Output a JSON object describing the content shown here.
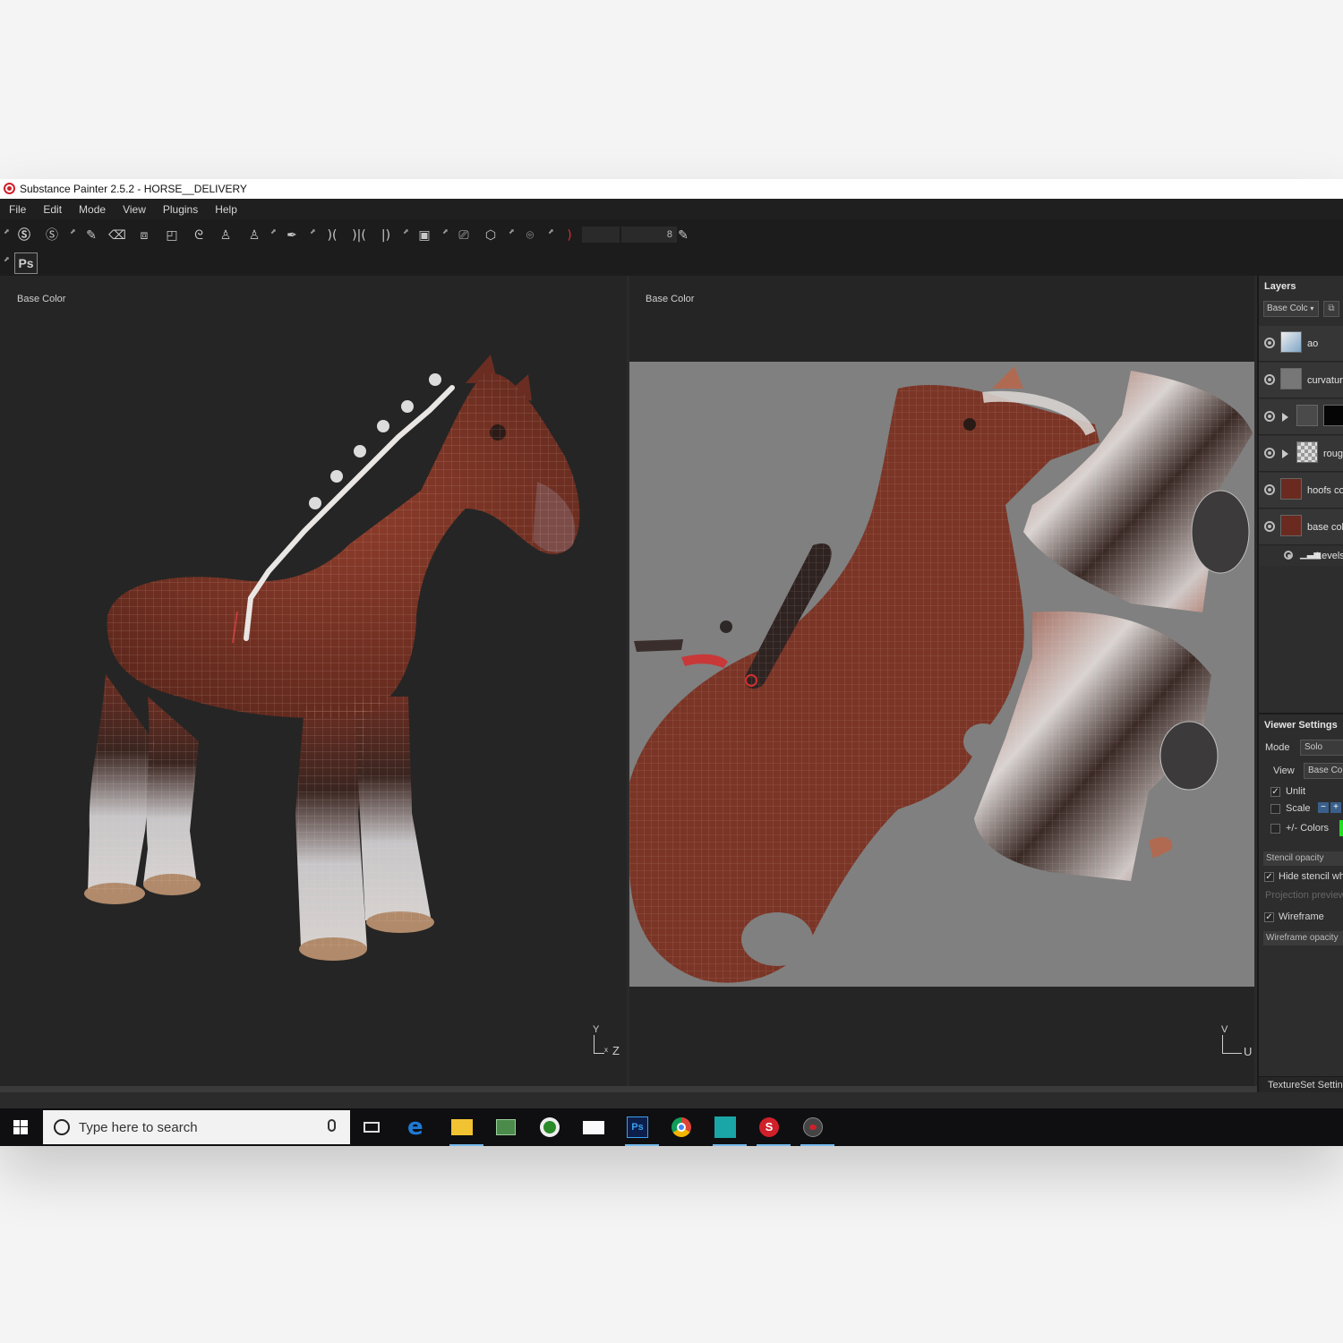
{
  "window": {
    "title": "Substance Painter 2.5.2 - HORSE__DELIVERY"
  },
  "menu": [
    "File",
    "Edit",
    "Mode",
    "View",
    "Plugins",
    "Help"
  ],
  "toolbar": {
    "brush_size": "8",
    "photoshop_label": "Ps"
  },
  "viewport_3d": {
    "label": "Base Color",
    "axis_y": "Y",
    "axis_h": "Z"
  },
  "viewport_2d": {
    "label": "Base Color",
    "axis_y": "V",
    "axis_h": "U"
  },
  "layers": {
    "title": "Layers",
    "channel": "Base Colc",
    "items": [
      {
        "name": "ao"
      },
      {
        "name": "curvatur"
      },
      {
        "name": ""
      },
      {
        "name": "roug"
      },
      {
        "name": "hoofs co"
      },
      {
        "name": "base colc"
      }
    ],
    "sub_effect": "Levels"
  },
  "viewer_settings": {
    "title": "Viewer Settings",
    "mode_label": "Mode",
    "mode_value": "Solo",
    "view_label": "View",
    "view_value": "Base Col",
    "unlit_label": "Unlit",
    "unlit_checked": true,
    "scale_label": "Scale",
    "colors_label": "+/- Colors",
    "colors_swatch": "#22dd22",
    "stencil_opacity": "Stencil opacity",
    "hide_stencil": "Hide stencil whe",
    "projection_preview": "Projection preview",
    "wireframe_label": "Wireframe",
    "wireframe_checked": true,
    "wireframe_opacity": "Wireframe opacity",
    "textureset": "TextureSet Settin"
  },
  "taskbar": {
    "search_placeholder": "Type here to search",
    "apps": [
      "task-view-icon",
      "edge-icon",
      "file-explorer-icon",
      "maps-icon",
      "xbox-icon",
      "mail-icon",
      "photoshop-icon",
      "chrome-icon",
      "substance-designer-icon",
      "substance-painter-icon",
      "substance-source-icon"
    ]
  },
  "colors": {
    "accent": "#d0202a",
    "horse_brown": "#7a3526",
    "uv_background": "#808080"
  }
}
